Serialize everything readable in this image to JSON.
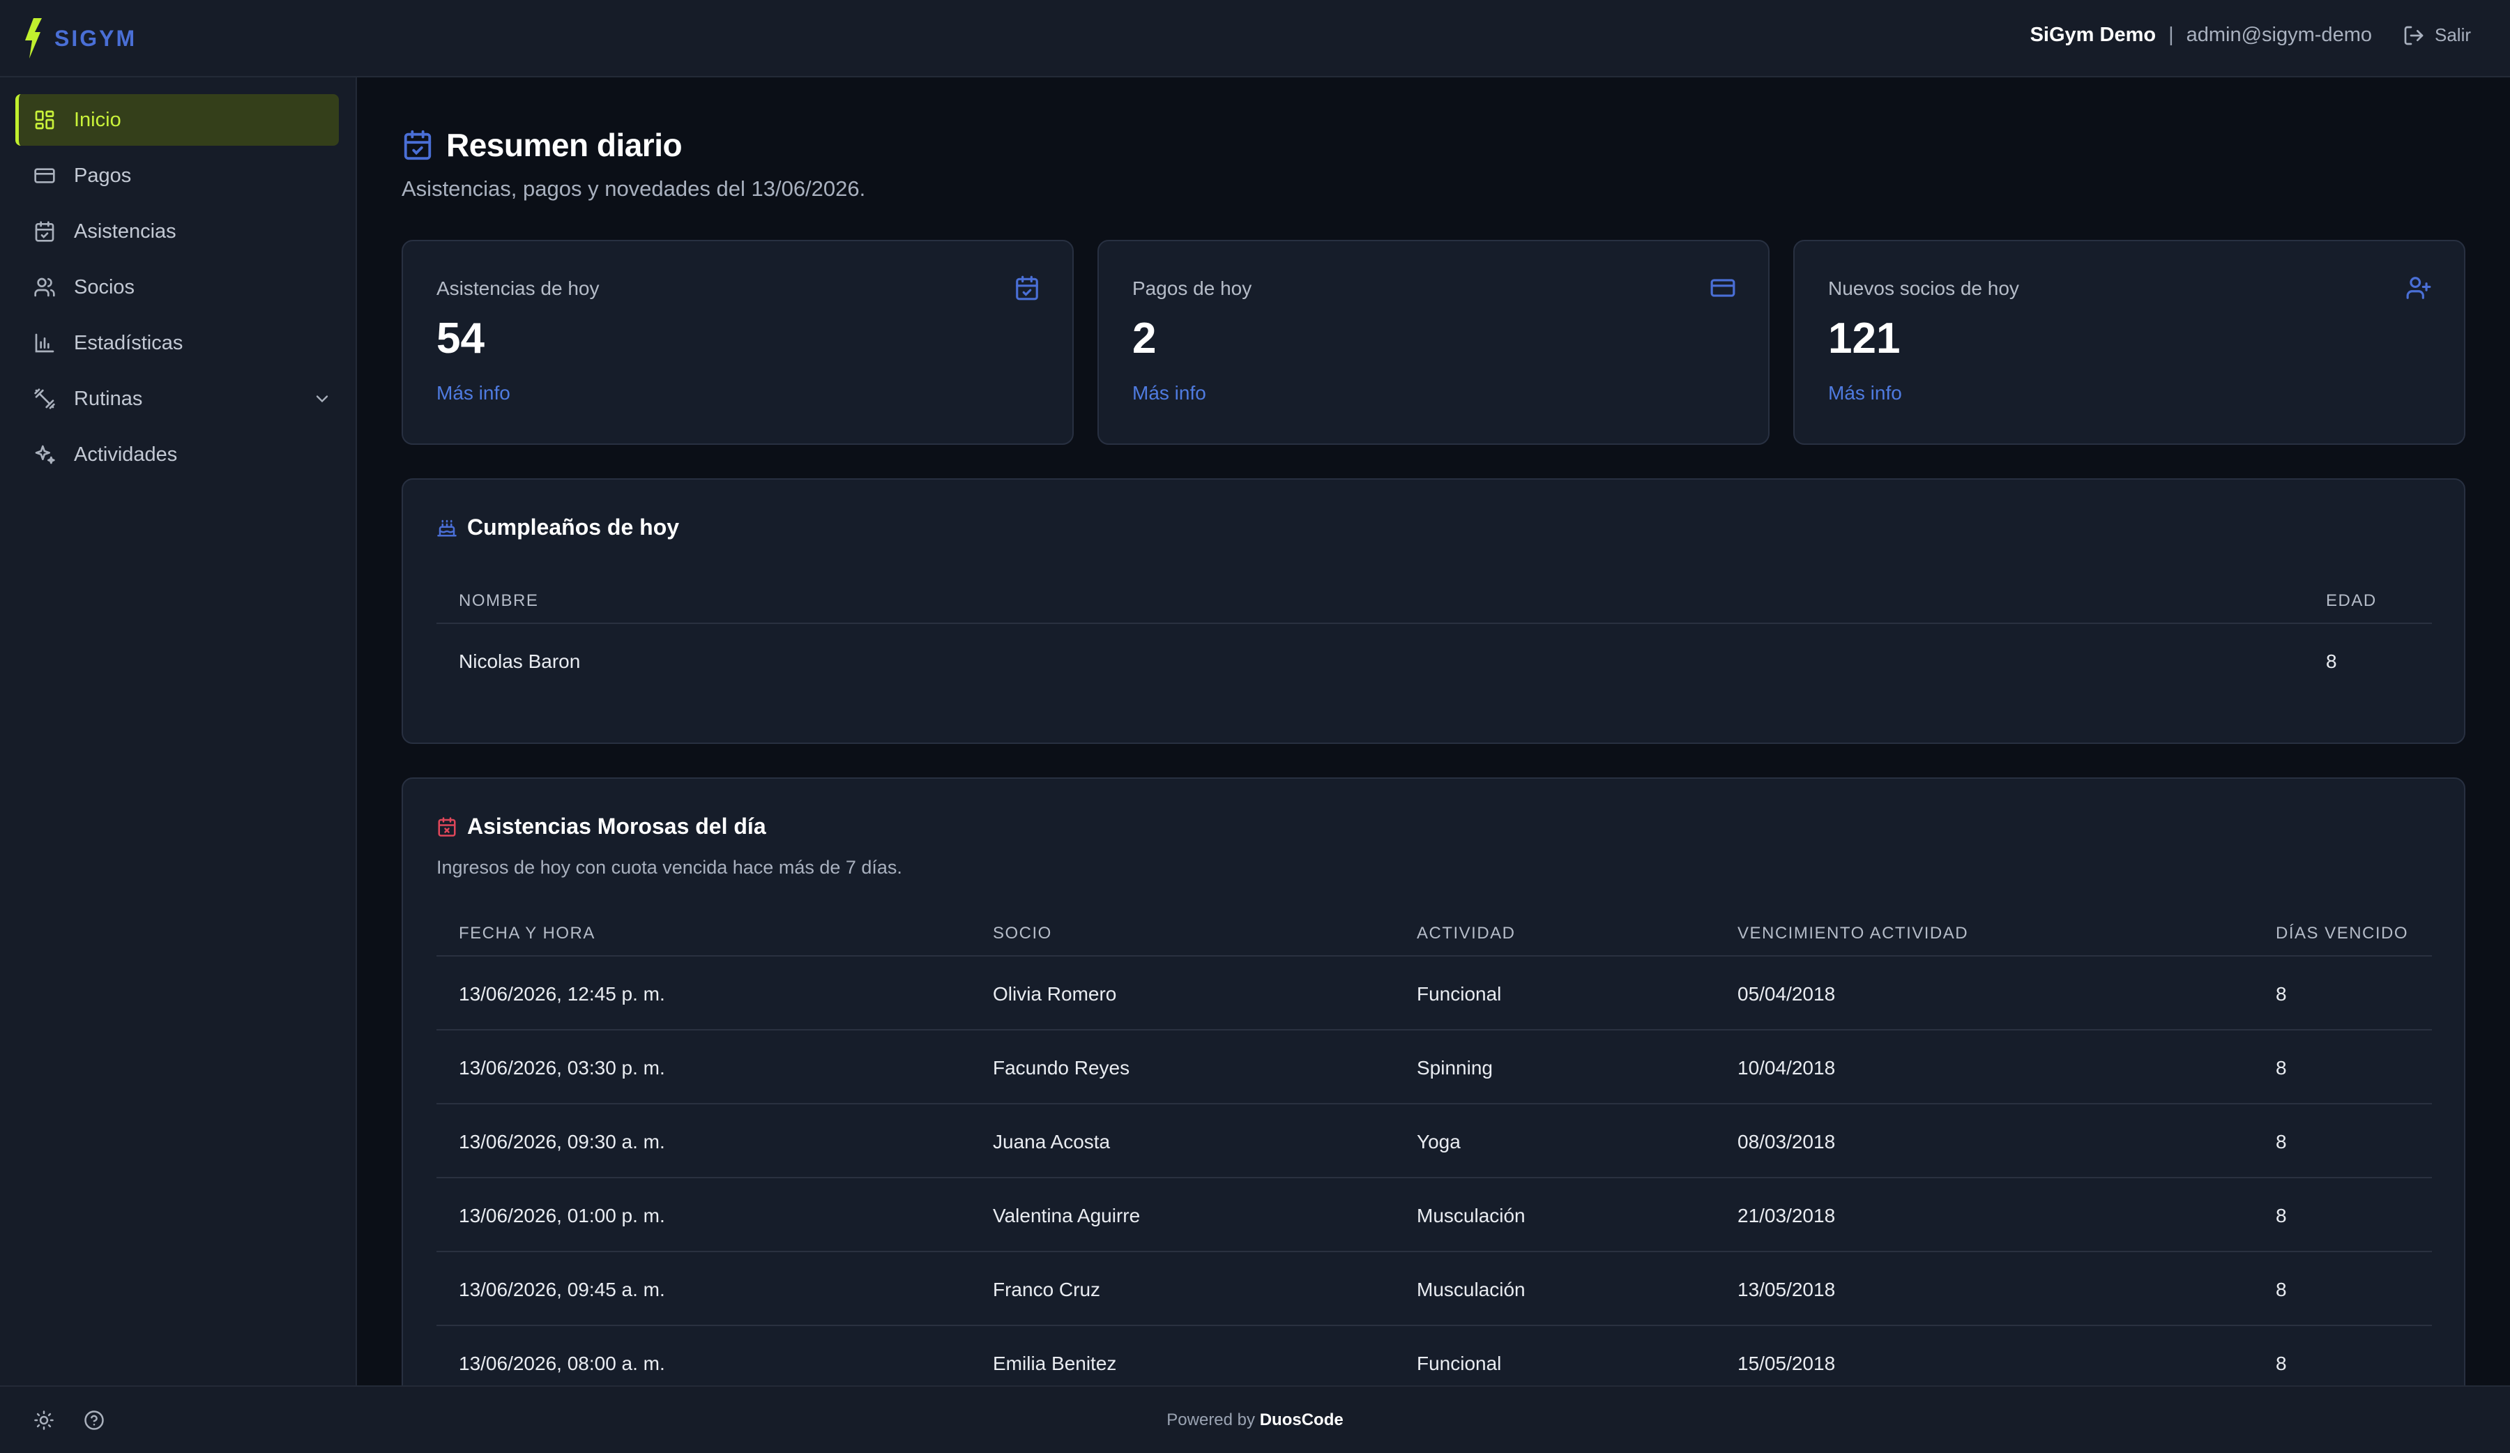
{
  "header": {
    "brand": "SIGYM",
    "user_name": "SiGym Demo",
    "separator": "|",
    "user_email": "admin@sigym-demo",
    "logout_label": "Salir"
  },
  "sidebar": {
    "items": [
      {
        "label": "Inicio",
        "icon": "dashboard-grid-icon",
        "active": true
      },
      {
        "label": "Pagos",
        "icon": "credit-card-icon"
      },
      {
        "label": "Asistencias",
        "icon": "calendar-check-icon"
      },
      {
        "label": "Socios",
        "icon": "users-icon"
      },
      {
        "label": "Estadísticas",
        "icon": "bar-chart-icon"
      },
      {
        "label": "Rutinas",
        "icon": "dumbbell-icon",
        "expandable": true
      },
      {
        "label": "Actividades",
        "icon": "sparkles-icon"
      }
    ]
  },
  "page": {
    "title": "Resumen diario",
    "subtitle": "Asistencias, pagos y novedades del 13/06/2026."
  },
  "stats": [
    {
      "label": "Asistencias de hoy",
      "value": "54",
      "link": "Más info",
      "icon": "calendar-check-icon"
    },
    {
      "label": "Pagos de hoy",
      "value": "2",
      "link": "Más info",
      "icon": "credit-card-icon"
    },
    {
      "label": "Nuevos socios de hoy",
      "value": "121",
      "link": "Más info",
      "icon": "user-plus-icon"
    }
  ],
  "birthdays": {
    "title": "Cumpleaños de hoy",
    "columns": {
      "name": "NOMBRE",
      "age": "EDAD"
    },
    "rows": [
      {
        "name": "Nicolas Baron",
        "age": "8"
      }
    ]
  },
  "overdue": {
    "title": "Asistencias Morosas del día",
    "subtitle": "Ingresos de hoy con cuota vencida hace más de 7 días.",
    "columns": {
      "datetime": "FECHA Y HORA",
      "member": "SOCIO",
      "activity": "ACTIVIDAD",
      "expiry": "VENCIMIENTO ACTIVIDAD",
      "days": "DÍAS VENCIDO"
    },
    "rows": [
      {
        "datetime": "13/06/2026, 12:45 p. m.",
        "member": "Olivia Romero",
        "activity": "Funcional",
        "expiry": "05/04/2018",
        "days": "8"
      },
      {
        "datetime": "13/06/2026, 03:30 p. m.",
        "member": "Facundo Reyes",
        "activity": "Spinning",
        "expiry": "10/04/2018",
        "days": "8"
      },
      {
        "datetime": "13/06/2026, 09:30 a. m.",
        "member": "Juana Acosta",
        "activity": "Yoga",
        "expiry": "08/03/2018",
        "days": "8"
      },
      {
        "datetime": "13/06/2026, 01:00 p. m.",
        "member": "Valentina Aguirre",
        "activity": "Musculación",
        "expiry": "21/03/2018",
        "days": "8"
      },
      {
        "datetime": "13/06/2026, 09:45 a. m.",
        "member": "Franco Cruz",
        "activity": "Musculación",
        "expiry": "13/05/2018",
        "days": "8"
      },
      {
        "datetime": "13/06/2026, 08:00 a. m.",
        "member": "Emilia Benitez",
        "activity": "Funcional",
        "expiry": "15/05/2018",
        "days": "8"
      }
    ]
  },
  "footer": {
    "powered_prefix": "Powered by",
    "powered_brand": "DuosCode",
    "icons": [
      "theme-toggle-sun-icon",
      "help-circle-icon"
    ]
  },
  "colors": {
    "accent_lime": "#c1f02e",
    "brand_blue": "#4a6fd6",
    "link_blue": "#4f7be0",
    "danger_red": "#e0475a",
    "background": "#0b0f17",
    "panel": "#161c28"
  }
}
